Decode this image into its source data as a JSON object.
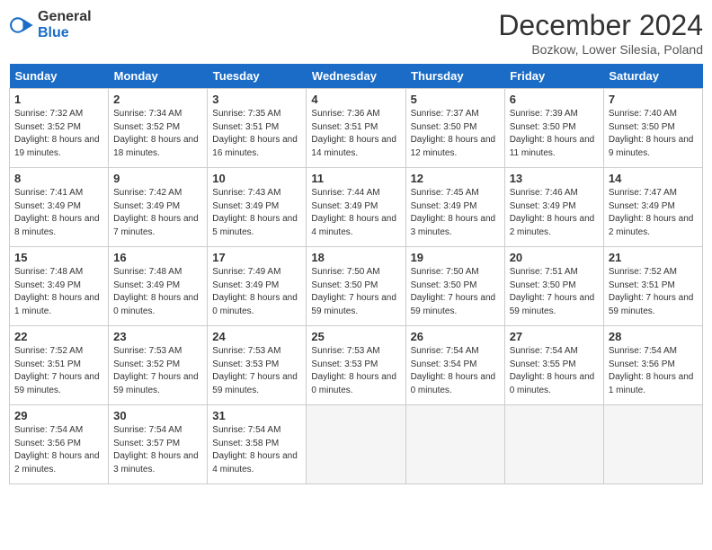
{
  "header": {
    "logo_general": "General",
    "logo_blue": "Blue",
    "title": "December 2024",
    "location": "Bozkow, Lower Silesia, Poland"
  },
  "days_of_week": [
    "Sunday",
    "Monday",
    "Tuesday",
    "Wednesday",
    "Thursday",
    "Friday",
    "Saturday"
  ],
  "weeks": [
    [
      {
        "day": 1,
        "info": "Sunrise: 7:32 AM\nSunset: 3:52 PM\nDaylight: 8 hours and 19 minutes."
      },
      {
        "day": 2,
        "info": "Sunrise: 7:34 AM\nSunset: 3:52 PM\nDaylight: 8 hours and 18 minutes."
      },
      {
        "day": 3,
        "info": "Sunrise: 7:35 AM\nSunset: 3:51 PM\nDaylight: 8 hours and 16 minutes."
      },
      {
        "day": 4,
        "info": "Sunrise: 7:36 AM\nSunset: 3:51 PM\nDaylight: 8 hours and 14 minutes."
      },
      {
        "day": 5,
        "info": "Sunrise: 7:37 AM\nSunset: 3:50 PM\nDaylight: 8 hours and 12 minutes."
      },
      {
        "day": 6,
        "info": "Sunrise: 7:39 AM\nSunset: 3:50 PM\nDaylight: 8 hours and 11 minutes."
      },
      {
        "day": 7,
        "info": "Sunrise: 7:40 AM\nSunset: 3:50 PM\nDaylight: 8 hours and 9 minutes."
      }
    ],
    [
      {
        "day": 8,
        "info": "Sunrise: 7:41 AM\nSunset: 3:49 PM\nDaylight: 8 hours and 8 minutes."
      },
      {
        "day": 9,
        "info": "Sunrise: 7:42 AM\nSunset: 3:49 PM\nDaylight: 8 hours and 7 minutes."
      },
      {
        "day": 10,
        "info": "Sunrise: 7:43 AM\nSunset: 3:49 PM\nDaylight: 8 hours and 5 minutes."
      },
      {
        "day": 11,
        "info": "Sunrise: 7:44 AM\nSunset: 3:49 PM\nDaylight: 8 hours and 4 minutes."
      },
      {
        "day": 12,
        "info": "Sunrise: 7:45 AM\nSunset: 3:49 PM\nDaylight: 8 hours and 3 minutes."
      },
      {
        "day": 13,
        "info": "Sunrise: 7:46 AM\nSunset: 3:49 PM\nDaylight: 8 hours and 2 minutes."
      },
      {
        "day": 14,
        "info": "Sunrise: 7:47 AM\nSunset: 3:49 PM\nDaylight: 8 hours and 2 minutes."
      }
    ],
    [
      {
        "day": 15,
        "info": "Sunrise: 7:48 AM\nSunset: 3:49 PM\nDaylight: 8 hours and 1 minute."
      },
      {
        "day": 16,
        "info": "Sunrise: 7:48 AM\nSunset: 3:49 PM\nDaylight: 8 hours and 0 minutes."
      },
      {
        "day": 17,
        "info": "Sunrise: 7:49 AM\nSunset: 3:49 PM\nDaylight: 8 hours and 0 minutes."
      },
      {
        "day": 18,
        "info": "Sunrise: 7:50 AM\nSunset: 3:50 PM\nDaylight: 7 hours and 59 minutes."
      },
      {
        "day": 19,
        "info": "Sunrise: 7:50 AM\nSunset: 3:50 PM\nDaylight: 7 hours and 59 minutes."
      },
      {
        "day": 20,
        "info": "Sunrise: 7:51 AM\nSunset: 3:50 PM\nDaylight: 7 hours and 59 minutes."
      },
      {
        "day": 21,
        "info": "Sunrise: 7:52 AM\nSunset: 3:51 PM\nDaylight: 7 hours and 59 minutes."
      }
    ],
    [
      {
        "day": 22,
        "info": "Sunrise: 7:52 AM\nSunset: 3:51 PM\nDaylight: 7 hours and 59 minutes."
      },
      {
        "day": 23,
        "info": "Sunrise: 7:53 AM\nSunset: 3:52 PM\nDaylight: 7 hours and 59 minutes."
      },
      {
        "day": 24,
        "info": "Sunrise: 7:53 AM\nSunset: 3:53 PM\nDaylight: 7 hours and 59 minutes."
      },
      {
        "day": 25,
        "info": "Sunrise: 7:53 AM\nSunset: 3:53 PM\nDaylight: 8 hours and 0 minutes."
      },
      {
        "day": 26,
        "info": "Sunrise: 7:54 AM\nSunset: 3:54 PM\nDaylight: 8 hours and 0 minutes."
      },
      {
        "day": 27,
        "info": "Sunrise: 7:54 AM\nSunset: 3:55 PM\nDaylight: 8 hours and 0 minutes."
      },
      {
        "day": 28,
        "info": "Sunrise: 7:54 AM\nSunset: 3:56 PM\nDaylight: 8 hours and 1 minute."
      }
    ],
    [
      {
        "day": 29,
        "info": "Sunrise: 7:54 AM\nSunset: 3:56 PM\nDaylight: 8 hours and 2 minutes."
      },
      {
        "day": 30,
        "info": "Sunrise: 7:54 AM\nSunset: 3:57 PM\nDaylight: 8 hours and 3 minutes."
      },
      {
        "day": 31,
        "info": "Sunrise: 7:54 AM\nSunset: 3:58 PM\nDaylight: 8 hours and 4 minutes."
      },
      null,
      null,
      null,
      null
    ]
  ]
}
